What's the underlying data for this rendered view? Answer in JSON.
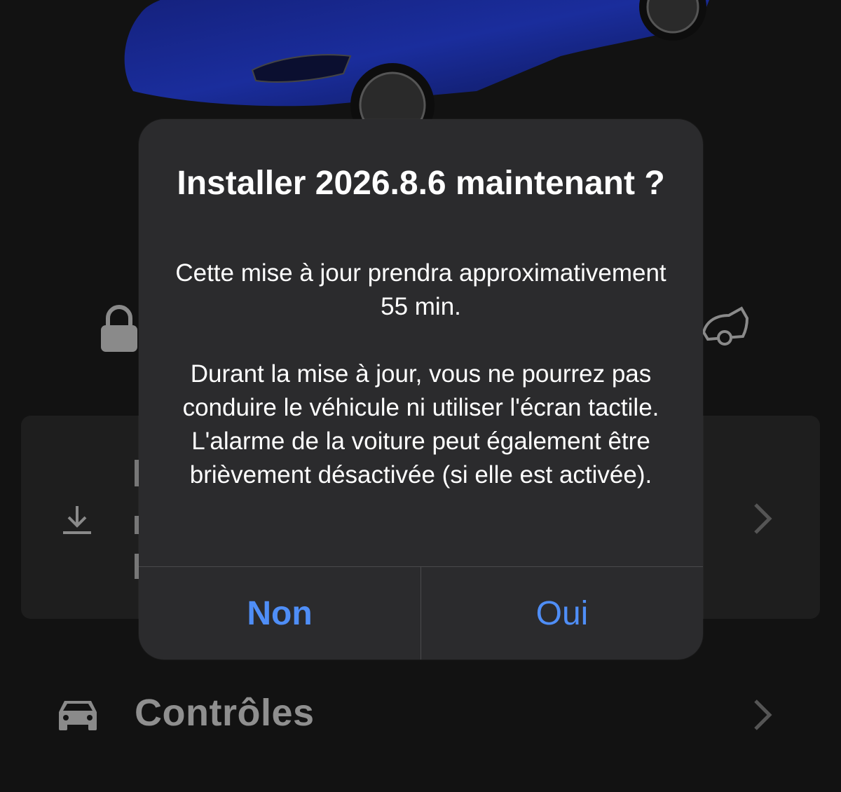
{
  "background": {
    "icons": {
      "lock": "lock-icon",
      "trunk": "car-trunk-icon",
      "download": "download-icon",
      "chevron": "chevron-right-icon",
      "car": "car-icon"
    },
    "controls_label": "Contrôles",
    "car_color": "#1a2d8c"
  },
  "alert": {
    "title": "Installer 2026.8.6 maintenant ?",
    "body_paragraph_1": "Cette mise à jour prendra approximativement 55 min.",
    "body_paragraph_2": "Durant la mise à jour, vous ne pourrez pas conduire le véhicule ni utiliser l'écran tactile. L'alarme de la voiture peut également être brièvement désactivée (si elle est activée).",
    "no_label": "Non",
    "yes_label": "Oui"
  },
  "colors": {
    "accent": "#4f8ef7",
    "alert_background": "#2b2b2d",
    "page_background": "#121212"
  }
}
